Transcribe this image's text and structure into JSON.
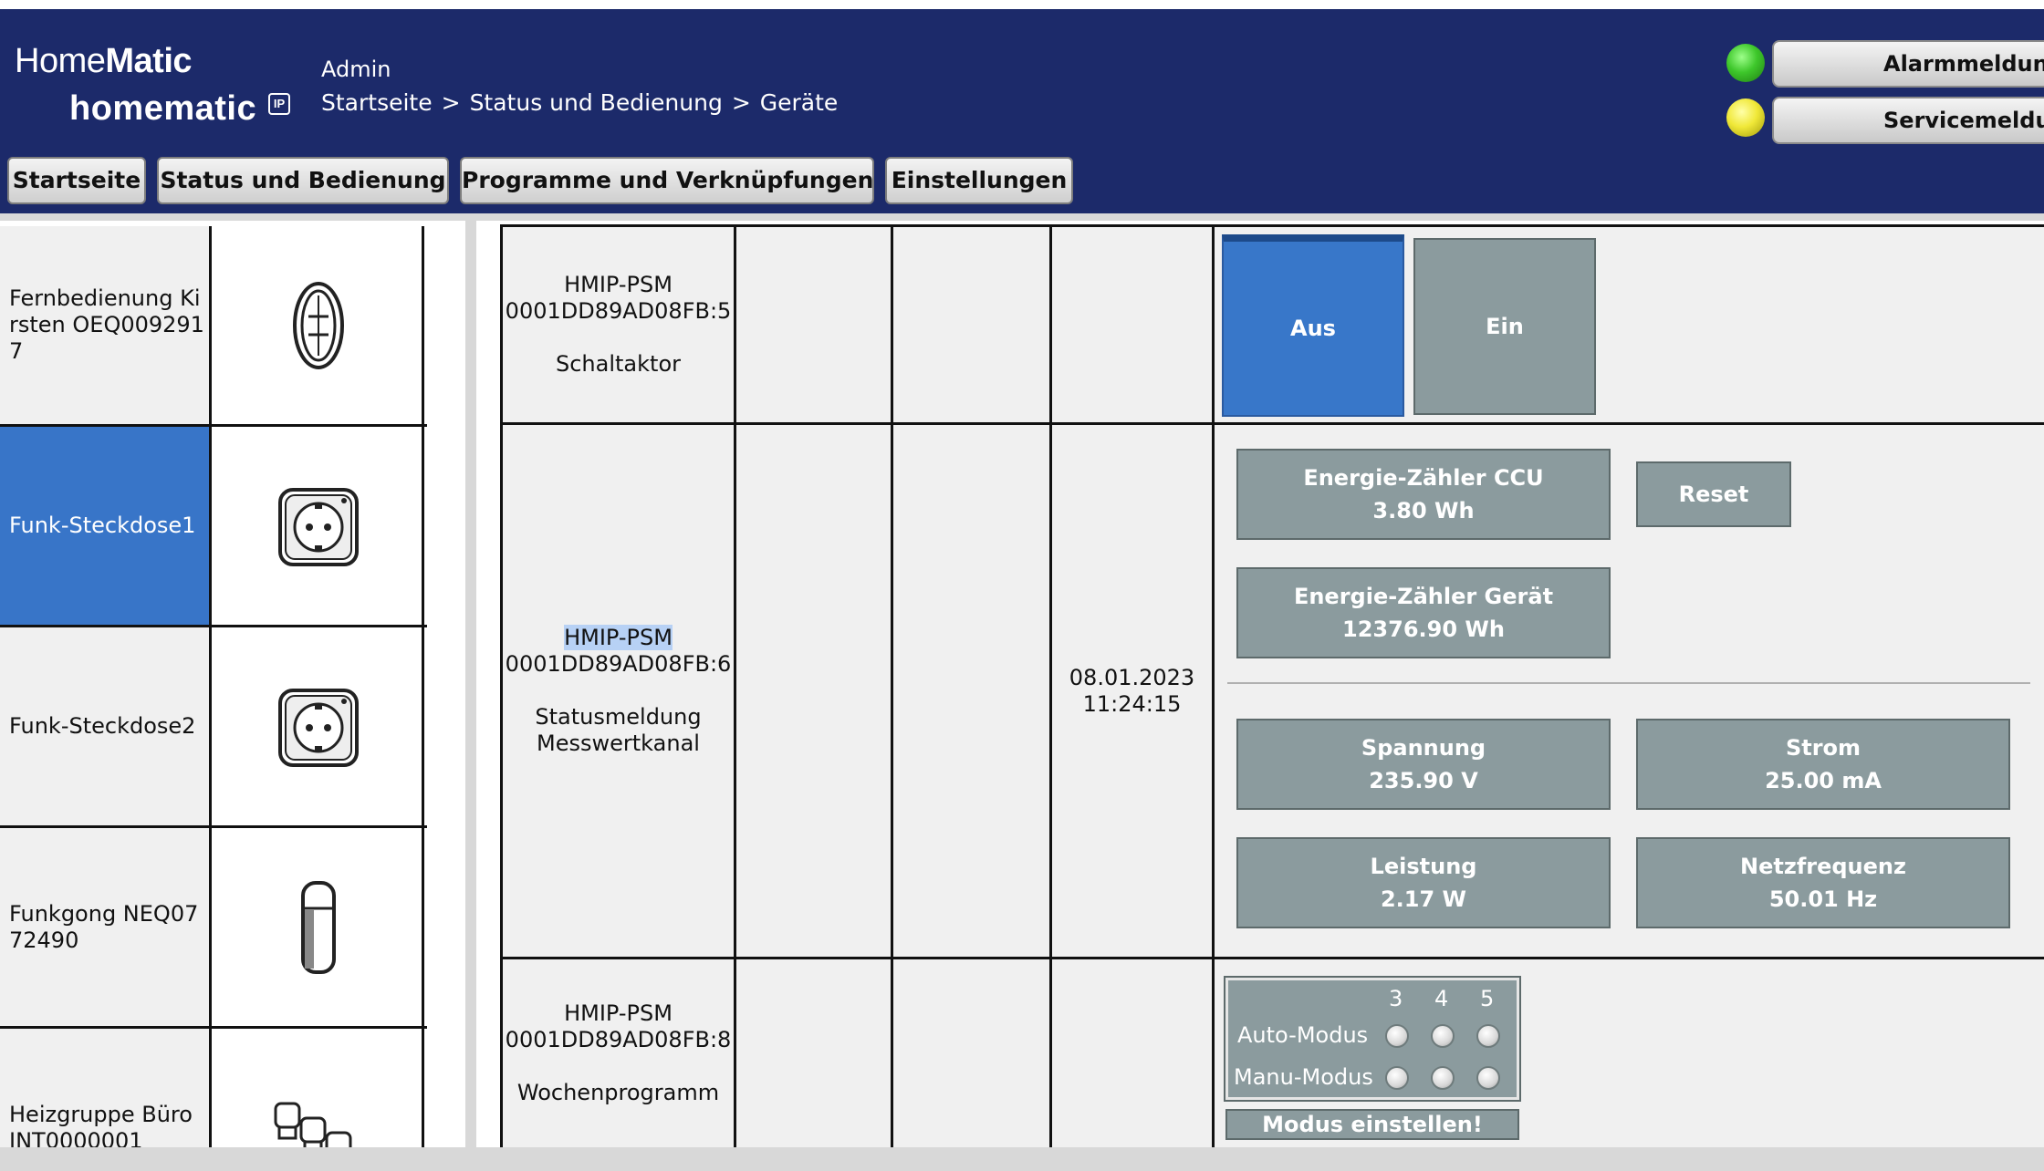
{
  "header": {
    "logo_line1_a": "Home",
    "logo_line1_b": "Matic",
    "logo_line2": "homematic",
    "logo_ip": "IP",
    "user": "Admin",
    "breadcrumb": [
      "Startseite",
      "Status und Bedienung",
      "Geräte"
    ],
    "breadcrumb_sep": ">",
    "alarm_button": "Alarmmeldungen",
    "service_button": "Servicemeldungen",
    "alarm_led_color": "#3ec72b",
    "service_led_color": "#f0e838"
  },
  "nav": [
    "Startseite",
    "Status und Bedienung",
    "Programme und Verknüpfungen",
    "Einstellungen"
  ],
  "devices": [
    {
      "name": "Fernbedienung Kirsten OEQ0092917",
      "icon": "remote-control-icon",
      "selected": false
    },
    {
      "name": "Funk-Steckdose1",
      "icon": "socket-adapter-icon",
      "selected": true
    },
    {
      "name": "Funk-Steckdose2",
      "icon": "socket-adapter-icon",
      "selected": false
    },
    {
      "name": "Funkgong NEQ0772490",
      "icon": "chime-icon",
      "selected": false
    },
    {
      "name": "Heizgruppe Büro INT0000001",
      "icon": "heating-group-icon",
      "selected": false
    }
  ],
  "channels": [
    {
      "type": "HMIP-PSM",
      "address": "0001DD89AD08FB:5",
      "function": "Schaltaktor",
      "timestamp_date": "",
      "timestamp_time": "",
      "buttons": {
        "off": "Aus",
        "on": "Ein"
      }
    },
    {
      "type": "HMIP-PSM",
      "address": "0001DD89AD08FB:6",
      "function_line1": "Statusmeldung",
      "function_line2": "Messwertkanal",
      "timestamp_date": "08.01.2023",
      "timestamp_time": "11:24:15",
      "energy_ccu": {
        "label": "Energie-Zähler CCU",
        "value": "3.80 Wh"
      },
      "reset": "Reset",
      "energy_device": {
        "label": "Energie-Zähler Gerät",
        "value": "12376.90 Wh"
      },
      "voltage": {
        "label": "Spannung",
        "value": "235.90 V"
      },
      "current": {
        "label": "Strom",
        "value": "25.00 mA"
      },
      "power": {
        "label": "Leistung",
        "value": "2.17 W"
      },
      "frequency": {
        "label": "Netzfrequenz",
        "value": "50.01 Hz"
      }
    },
    {
      "type": "HMIP-PSM",
      "address": "0001DD89AD08FB:8",
      "function": "Wochenprogramm",
      "mode_columns": [
        "3",
        "4",
        "5"
      ],
      "auto_mode": "Auto-Modus",
      "manu_mode": "Manu-Modus",
      "set_mode": "Modus einstellen!"
    }
  ]
}
